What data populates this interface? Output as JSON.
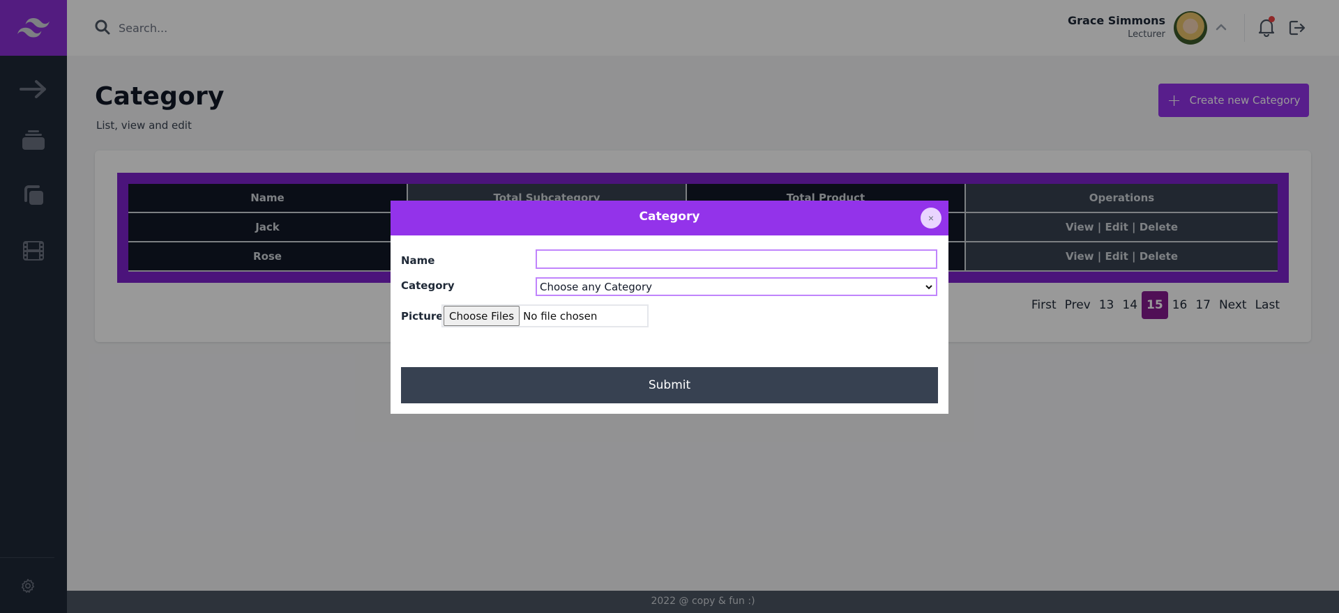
{
  "header": {
    "search_placeholder": "Search...",
    "user": {
      "name": "Grace Simmons",
      "role": "Lecturer"
    },
    "notification_dot_color": "#ef4444"
  },
  "sidebar": {
    "items": [
      {
        "icon": "arrow-right-icon"
      },
      {
        "icon": "inbox-stack-icon"
      },
      {
        "icon": "copy-icon"
      },
      {
        "icon": "film-icon"
      }
    ],
    "bottom_icon": "gear-icon"
  },
  "page": {
    "title": "Category",
    "subtitle": "List, view and edit",
    "create_button": {
      "icon": "+",
      "label": "Create new Category"
    }
  },
  "table": {
    "columns": [
      "Name",
      "Total Subcategory",
      "Total Product",
      "Operations"
    ],
    "rows": [
      {
        "name": "Jack",
        "total_subcategory": "",
        "total_product": "",
        "operations": [
          "View",
          "Edit",
          "Delete"
        ]
      },
      {
        "name": "Rose",
        "total_subcategory": "",
        "total_product": "",
        "operations": [
          "View",
          "Edit",
          "Delete"
        ]
      }
    ],
    "operation_separator": "|"
  },
  "pagination": {
    "items": [
      "First",
      "Prev",
      "13",
      "14",
      "15",
      "16",
      "17",
      "Next",
      "Last"
    ],
    "current": "15"
  },
  "footer": {
    "text": "2022 @ copy & fun :)"
  },
  "modal": {
    "title": "Category",
    "close_label": "×",
    "fields": {
      "name": {
        "label": "Name",
        "value": "",
        "placeholder": ""
      },
      "category": {
        "label": "Category",
        "selected": "Choose any Category"
      },
      "picture": {
        "label": "Picture",
        "button_label": "Choose Files",
        "status": "No file chosen"
      }
    },
    "submit_label": "Submit"
  },
  "colors": {
    "accent": "#9333ea",
    "sidebar_bg": "#1f2937",
    "table_frame": "#7e22ce",
    "active_page": "#86198f",
    "submit_bg": "#374151"
  }
}
